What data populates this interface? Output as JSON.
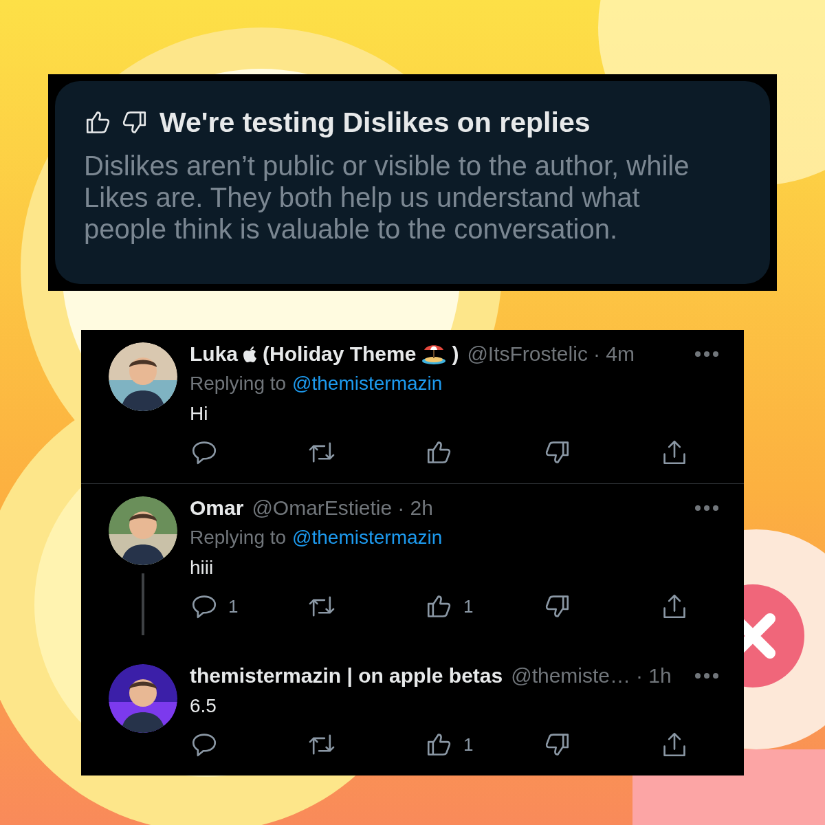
{
  "notice": {
    "title": "We're testing Dislikes on replies",
    "body": "Dislikes aren’t public or visible to the author, while Likes are. They both help us understand what people think is valuable to the conversation."
  },
  "tweets": [
    {
      "name_parts": [
        {
          "kind": "text",
          "text": "Luka"
        },
        {
          "kind": "apple_logo"
        },
        {
          "kind": "text",
          "text": "(Holiday Theme"
        },
        {
          "kind": "beach_emoji"
        },
        {
          "kind": "text",
          "text": ")"
        }
      ],
      "handle": "@ItsFrostelic",
      "time": "· 4m",
      "replying_label": "Replying to",
      "replying_to": "@themistermazin",
      "text": "Hi",
      "has_thread_line": false,
      "actions": [
        {
          "kind": "reply"
        },
        {
          "kind": "retweet"
        },
        {
          "kind": "like"
        },
        {
          "kind": "dislike"
        },
        {
          "kind": "share"
        }
      ]
    },
    {
      "name_parts": [
        {
          "kind": "text",
          "text": "Omar"
        }
      ],
      "handle": "@OmarEstietie",
      "time": "· 2h",
      "replying_label": "Replying to",
      "replying_to": "@themistermazin",
      "text": "hiii",
      "has_thread_line": true,
      "actions": [
        {
          "kind": "reply",
          "count": "1"
        },
        {
          "kind": "retweet"
        },
        {
          "kind": "like",
          "count": "1"
        },
        {
          "kind": "dislike"
        },
        {
          "kind": "share"
        }
      ]
    },
    {
      "name_parts": [
        {
          "kind": "text",
          "text": "themistermazin | on apple betas"
        }
      ],
      "handle": "@themiste…",
      "time": "· 1h",
      "text": "6.5",
      "has_thread_line": false,
      "actions": [
        {
          "kind": "reply"
        },
        {
          "kind": "retweet"
        },
        {
          "kind": "like",
          "count": "1"
        },
        {
          "kind": "dislike"
        },
        {
          "kind": "share"
        }
      ]
    }
  ]
}
